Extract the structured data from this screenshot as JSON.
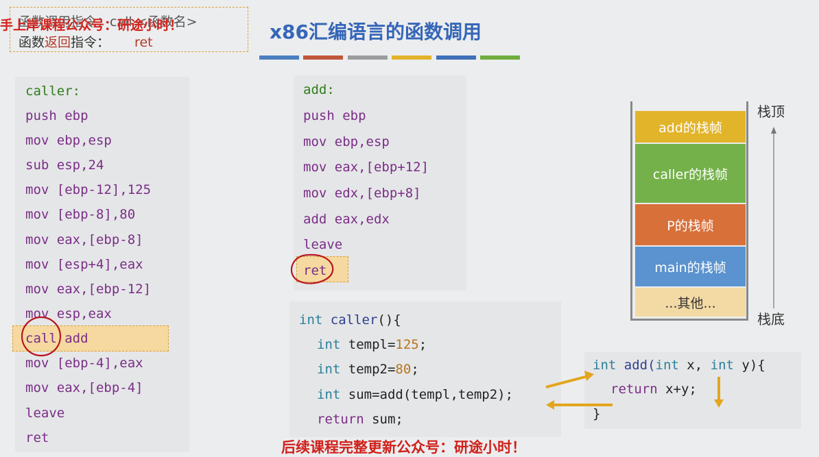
{
  "header_box": {
    "line1": "函数调用指令：call <函数名>",
    "line2_prefix": "函数",
    "line2_red": "返回",
    "line2_suffix": "指令：",
    "line2_code": "ret"
  },
  "watermark_top": "手上岸课程公众号：研途小时！",
  "title": "x86汇编语言的函数调用",
  "title_bars_colors": [
    "#4a7fbf",
    "#c0563a",
    "#9c9c9c",
    "#e2b32a",
    "#3f6fb8",
    "#6fae3e"
  ],
  "caller_code": [
    "caller:",
    "push ebp",
    "mov ebp,esp",
    "sub esp,24",
    "mov [ebp-12],125",
    "mov [ebp-8],80",
    "mov eax,[ebp-8]",
    "mov [esp+4],eax",
    "mov eax,[ebp-12]",
    "mov esp,eax",
    "call  add",
    "mov [ebp-4],eax",
    "mov eax,[ebp-4]",
    "leave",
    "ret"
  ],
  "add_code": [
    "add:",
    "push ebp",
    "mov ebp,esp",
    "mov eax,[ebp+12]",
    "mov edx,[ebp+8]",
    "add eax,edx",
    "leave",
    "ret"
  ],
  "c_caller": {
    "l1": [
      "int",
      " caller",
      "(){"
    ],
    "l2": [
      "int",
      " templ",
      "=",
      "125",
      ";"
    ],
    "l3": [
      "int",
      " temp2",
      "=",
      "80",
      ";"
    ],
    "l4": [
      "int",
      " sum",
      "=",
      "add(templ,temp2);"
    ],
    "l5": [
      "return",
      " sum;"
    ]
  },
  "c_add": {
    "l1": [
      "int",
      " add(",
      "int",
      " x, ",
      "int",
      " y){"
    ],
    "l2": [
      "return",
      " x+y;"
    ],
    "l3": "}"
  },
  "stack": {
    "top_label": "栈顶",
    "bottom_label": "栈底",
    "frames": [
      {
        "label": "add的栈帧",
        "color": "#e2b42a"
      },
      {
        "label": "caller的栈帧",
        "color": "#74b14a"
      },
      {
        "label": "P的栈帧",
        "color": "#d8703a"
      },
      {
        "label": "main的栈帧",
        "color": "#5a93cf"
      },
      {
        "label": "...其他...",
        "color": "#f3d9a4"
      }
    ]
  },
  "watermark_bottom": "后续课程完整更新公众号：研途小时！"
}
